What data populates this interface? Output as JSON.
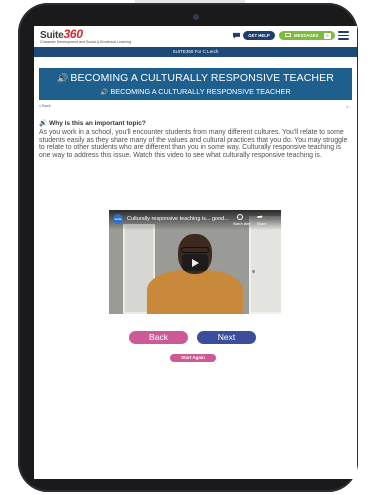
{
  "header": {
    "logo_text": "Suite",
    "logo_num": "360",
    "tagline": "Character Development and Social & Emotional Learning",
    "get_help": "GET HELP",
    "messages_label": "MESSAGES",
    "messages_count": "0"
  },
  "course_bar": {
    "label": "SUITE360 For C.Lerch"
  },
  "lesson": {
    "title_main": "BECOMING A CULTURALLY RESPONSIVE TEACHER",
    "title_sub": "BECOMING A CULTURALLY RESPONSIVE TEACHER",
    "back_link": "« Back",
    "question": "Why is this an important topic?",
    "paragraph": "As you work in a school, you'll encounter students from many different cultures. You'll relate to some students easily as they share many of the values and cultural practices that you do. You may struggle to relate to other students who are different than you in some way. Culturally responsive teaching is one way to address this issue. Watch this video to see what culturally responsive teaching is."
  },
  "video": {
    "title": "Culturally responsive teaching is... good...",
    "channel_badge": "suite",
    "watch_later": "Watch later",
    "share": "Share"
  },
  "buttons": {
    "back": "Back",
    "next": "Next",
    "start_again": "Start Again"
  },
  "colors": {
    "navy": "#1e4a7a",
    "title_blue": "#1e5f8e",
    "accent_orange": "#f07d2a",
    "pink": "#cc5a97",
    "indigo": "#3c4e9b",
    "green": "#7dbb3c"
  }
}
